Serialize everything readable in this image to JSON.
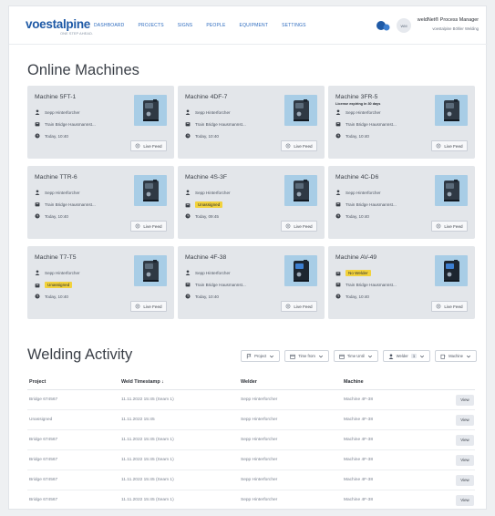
{
  "brand": {
    "name": "voestalpine",
    "tagline": "ONE STEP AHEAD."
  },
  "nav": {
    "links": [
      "DASHBOARD",
      "PROJECTS",
      "SIGNS",
      "PEOPLE",
      "EQUIPMENT",
      "SETTINGS"
    ],
    "avatar_initials": "WM",
    "user_name": "weldNet® Process Manager",
    "user_org": "voestalpine Böhler Welding"
  },
  "online": {
    "title": "Online Machines",
    "live_label": "Live Feed",
    "machines": [
      {
        "name": "Machine 5FT-1",
        "operator": "Sepp Hinterforcher",
        "location": "Train Bridge Hausmannst...",
        "time": "Today, 10:40",
        "thumb": "light"
      },
      {
        "name": "Machine 4DF-7",
        "operator": "Sepp Hinterforcher",
        "location": "Train Bridge Hausmannst...",
        "time": "Today, 10:40",
        "thumb": "light"
      },
      {
        "name": "Machine 3FR-5",
        "notice": "License expiring in 30 days",
        "operator": "Sepp Hinterforcher",
        "location": "Train Bridge Hausmannst...",
        "time": "Today, 10:40",
        "thumb": "light"
      },
      {
        "name": "Machine TTR-6",
        "operator": "Sepp Hinterforcher",
        "location": "Train Bridge Hausmannst...",
        "time": "Today, 10:40",
        "thumb": "light"
      },
      {
        "name": "Machine 4S-3F",
        "operator": "Sepp Hinterforcher",
        "tag": "Unassigned",
        "time": "Today, 09:45",
        "thumb": "light"
      },
      {
        "name": "Machine 4C-D6",
        "operator": "Sepp Hinterforcher",
        "location": "Train Bridge Hausmannst...",
        "time": "Today, 10:40",
        "thumb": "light"
      },
      {
        "name": "Machine T7-T5",
        "operator": "Sepp Hinterforcher",
        "tag": "Unassigned",
        "time": "Today, 10:40",
        "thumb": "light"
      },
      {
        "name": "Machine 4F-38",
        "operator": "Sepp Hinterforcher",
        "location": "Train Bridge Hausmannst...",
        "time": "Today, 10:40",
        "thumb": "dark"
      },
      {
        "name": "Machine AV-49",
        "tag": "No Welder",
        "location": "Train Bridge Hausmannst...",
        "time": "Today, 10:40",
        "thumb": "dark"
      }
    ]
  },
  "activity": {
    "title": "Welding Activity",
    "filters": [
      {
        "label": "Project",
        "icon": "flag-icon"
      },
      {
        "label": "Time from",
        "icon": "calendar-icon"
      },
      {
        "label": "Time Until",
        "icon": "calendar-icon"
      },
      {
        "label": "Welder",
        "icon": "person-icon",
        "badge": "1"
      },
      {
        "label": "Machine",
        "icon": "machine-icon"
      }
    ],
    "columns": [
      "Project",
      "Weld Timestamp ↓",
      "Welder",
      "Machine"
    ],
    "view_label": "View",
    "rows": [
      [
        "Bridge 674567",
        "11.11.2022 15:45 (Seam 1)",
        "Sepp Hinterforcher",
        "Machine 4F-38"
      ],
      [
        "Unassigned",
        "11.11.2022 15:45",
        "Sepp Hinterforcher",
        "Machine 4F-38"
      ],
      [
        "Bridge 674567",
        "11.11.2022 15:45 (Seam 1)",
        "Sepp Hinterforcher",
        "Machine 4F-38"
      ],
      [
        "Bridge 674567",
        "11.11.2022 15:45 (Seam 1)",
        "Sepp Hinterforcher",
        "Machine 4F-38"
      ],
      [
        "Bridge 674567",
        "11.11.2022 15:45 (Seam 1)",
        "Sepp Hinterforcher",
        "Machine 4F-38"
      ],
      [
        "Bridge 674567",
        "11.11.2022 15:45 (Seam 1)",
        "Sepp Hinterforcher",
        "Machine 4F-38"
      ]
    ]
  },
  "colors": {
    "brand": "#1f5aa6",
    "card_bg": "#e3e6ea",
    "thumb_bg": "#a8cde6",
    "tag": "#f2d23c"
  }
}
